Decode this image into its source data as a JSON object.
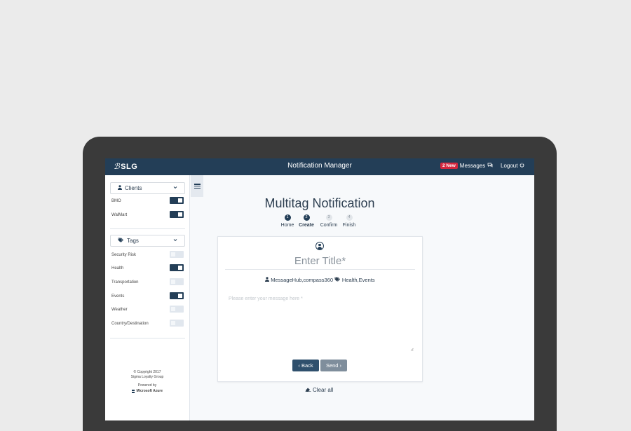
{
  "app": {
    "logo_mark": "ℬ",
    "logo_text": "SLG",
    "title": "Notification Manager"
  },
  "header": {
    "badge": "2 New",
    "messages_label": "Messages",
    "messages_icon": "chat-icon",
    "logout_label": "Logout",
    "logout_icon": "power-icon"
  },
  "sidebar": {
    "clients_label": "Clients",
    "clients": [
      {
        "label": "BMO",
        "on": true
      },
      {
        "label": "WalMart",
        "on": true
      }
    ],
    "tags_label": "Tags",
    "tags": [
      {
        "label": "Security Risk",
        "on": false
      },
      {
        "label": "Health",
        "on": true
      },
      {
        "label": "Transportation",
        "on": false
      },
      {
        "label": "Events",
        "on": true
      },
      {
        "label": "Weather",
        "on": false
      },
      {
        "label": "Country/Destination",
        "on": false
      }
    ],
    "footer": {
      "copyright": "© Copyright 2017",
      "company": "Sigma Loyalty Group",
      "powered_by": "Powered by",
      "azure": "Microsoft Azure"
    }
  },
  "main": {
    "title": "Multitag Notification",
    "steps": [
      {
        "num": "1",
        "label": "Home",
        "active": true
      },
      {
        "num": "2",
        "label": "Create",
        "active": true
      },
      {
        "num": "3",
        "label": "Confirm",
        "active": false
      },
      {
        "num": "4",
        "label": "Finish",
        "active": false
      }
    ],
    "title_placeholder": "Enter Title*",
    "clients_meta": "MessageHub,compass360",
    "tags_meta": "Health,Events",
    "message_placeholder": "Please enter your message here *",
    "back_label": "‹ Back",
    "send_label": "Send ›",
    "clear_label": "Clear all"
  },
  "colors": {
    "navy": "#233e57",
    "badge_red": "#d4263e",
    "send_gray": "#7f8e9c"
  }
}
